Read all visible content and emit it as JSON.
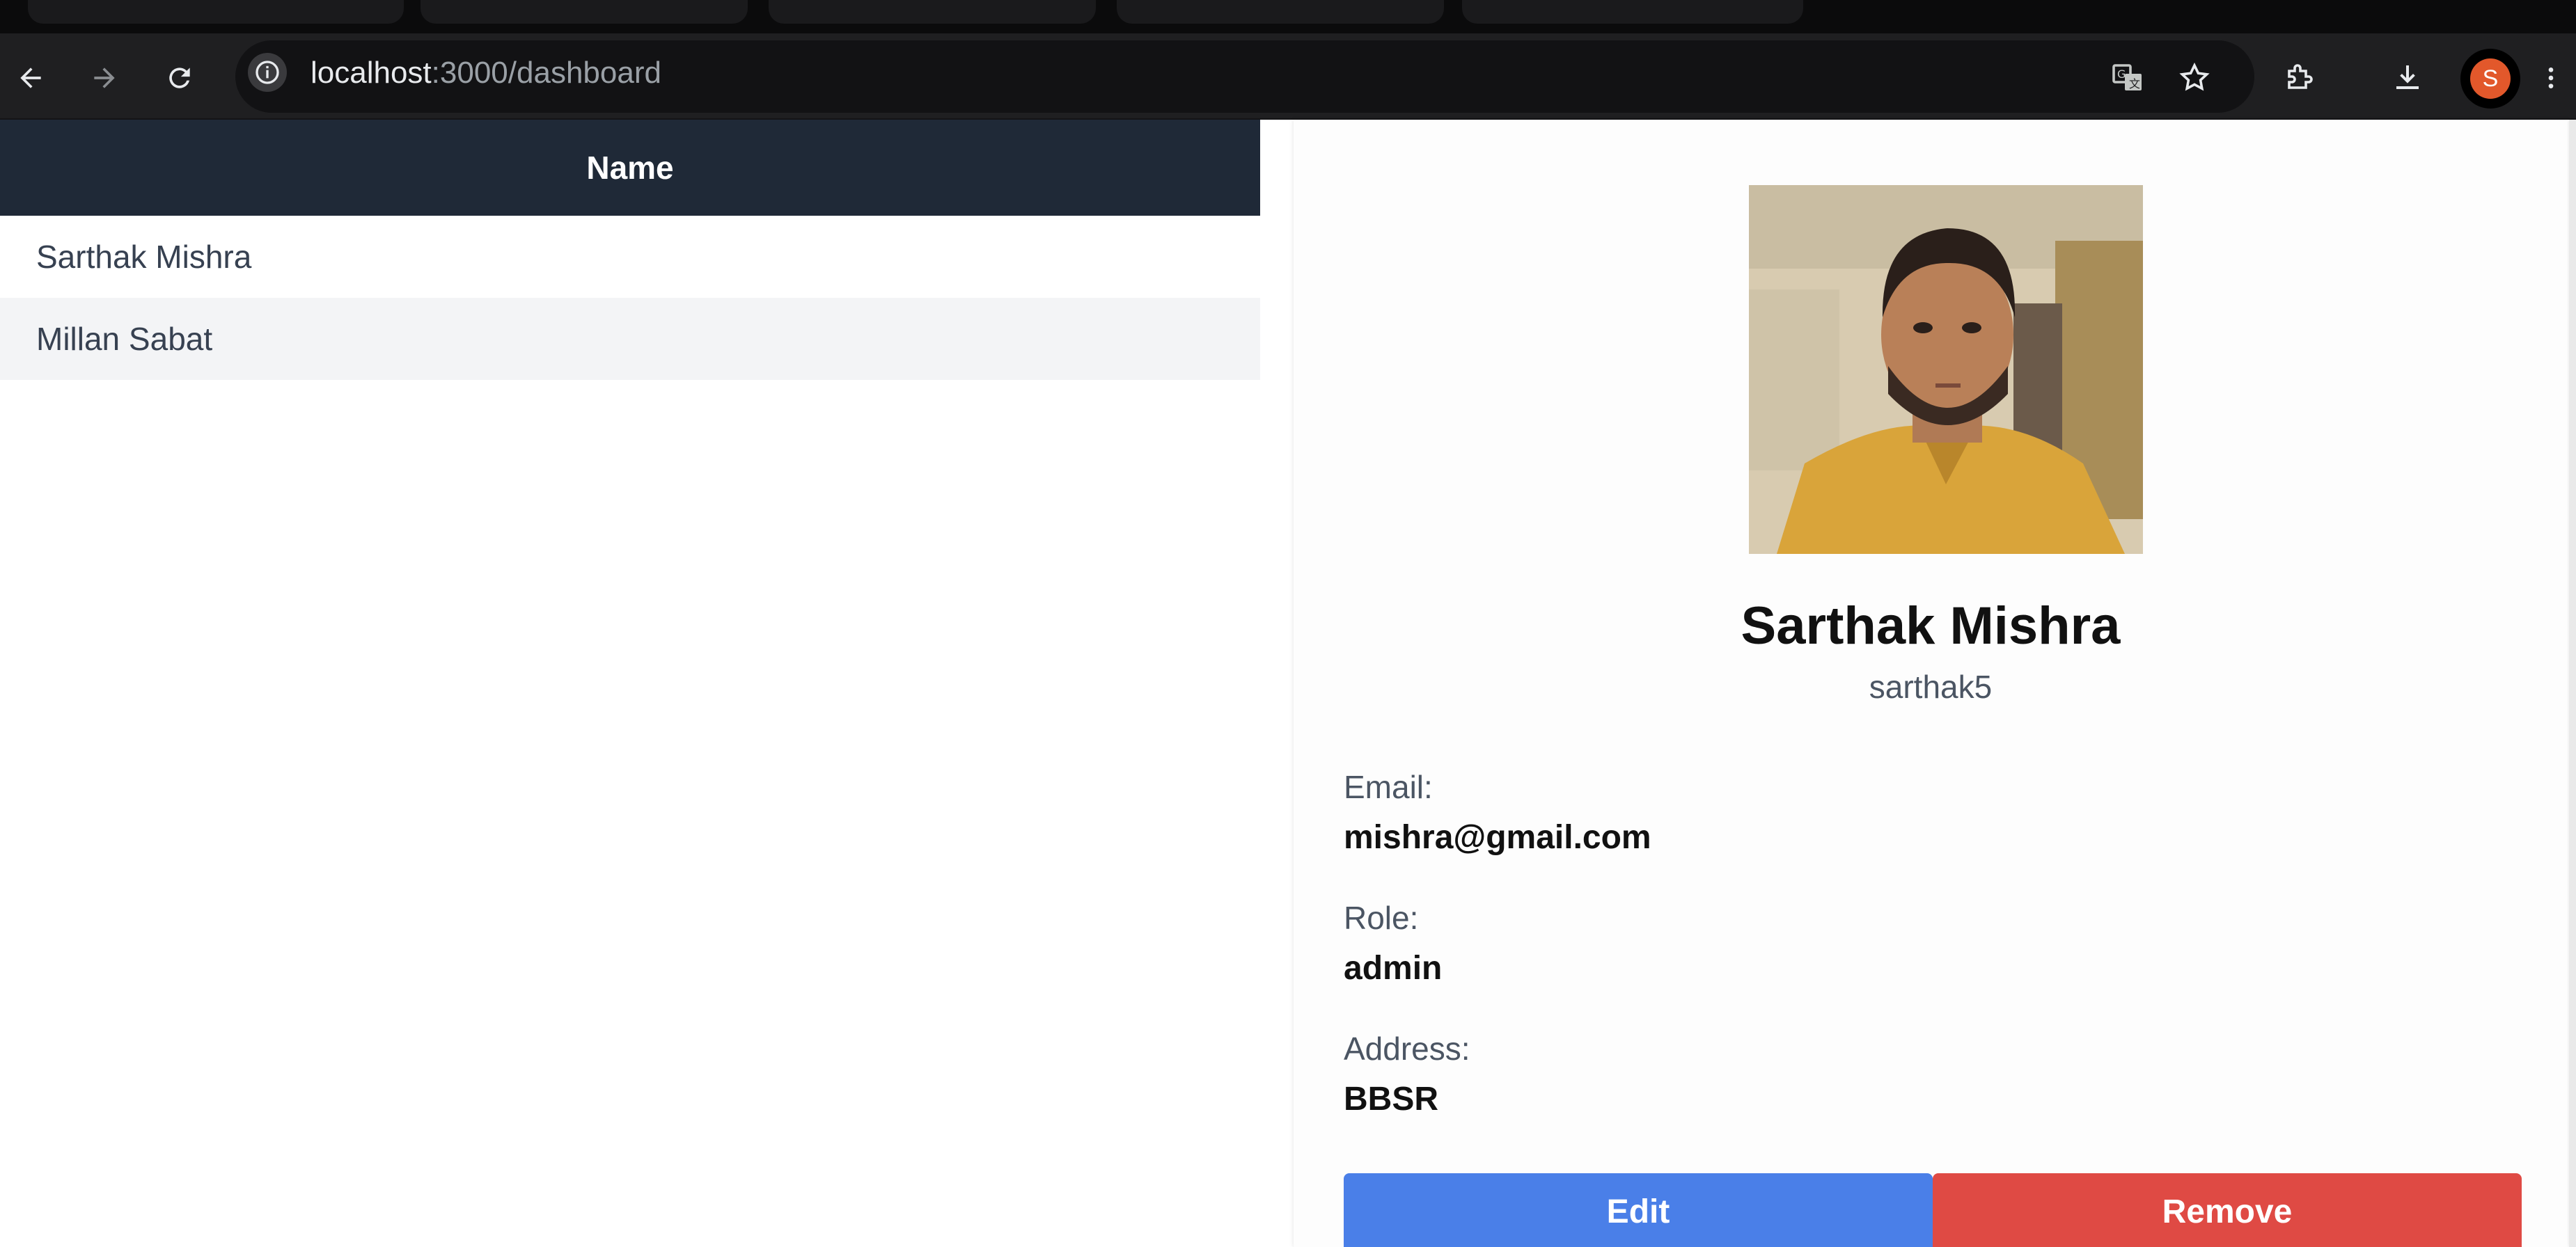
{
  "browser": {
    "url_host": "localhost",
    "url_path": ":3000/dashboard",
    "profile_initial": "S",
    "profile_color": "#e2582b"
  },
  "table": {
    "header": "Name",
    "rows": [
      "Sarthak Mishra",
      "Millan Sabat"
    ]
  },
  "profile": {
    "full_name": "Sarthak Mishra",
    "username": "sarthak5",
    "email_label": "Email:",
    "email": "mishra@gmail.com",
    "role_label": "Role:",
    "role": "admin",
    "address_label": "Address:",
    "address": "BBSR"
  },
  "actions": {
    "edit_label": "Edit",
    "remove_label": "Remove",
    "edit_color": "#4a7fe8",
    "remove_color": "#df4a44"
  },
  "icons": [
    "back-icon",
    "forward-icon",
    "reload-icon",
    "info-icon",
    "translate-icon",
    "bookmark-star-icon",
    "extensions-icon",
    "download-icon",
    "more-vert-icon"
  ]
}
